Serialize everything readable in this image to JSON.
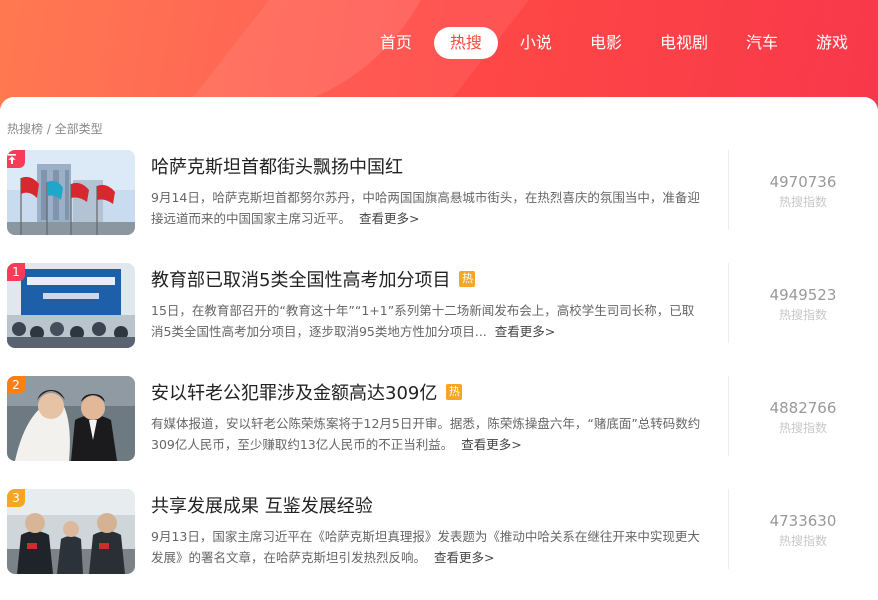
{
  "nav": {
    "items": [
      "首页",
      "热搜",
      "小说",
      "电影",
      "电视剧",
      "汽车",
      "游戏"
    ],
    "active": "热搜"
  },
  "breadcrumb": "热搜榜 / 全部类型",
  "colors": {
    "brand": "#f5493c",
    "rank_top": "#f73c5a",
    "rank_1": "#f73c5a",
    "rank_2": "#ff7f10",
    "rank_3": "#f5a623",
    "hot_badge": "#f5a623"
  },
  "more_label": "查看更多>",
  "score_label": "热搜指数",
  "items": [
    {
      "rank": "置顶",
      "rank_icon": "pin-icon",
      "title": "哈萨克斯坦首都街头飘扬中国红",
      "hot": false,
      "desc": "9月14日，哈萨克斯坦首都努尔苏丹，中哈两国国旗高悬城市街头，在热烈喜庆的氛围当中，准备迎接远道而来的中国国家主席习近平。",
      "score": "4970736"
    },
    {
      "rank": "1",
      "title": "教育部已取消5类全国性高考加分项目",
      "hot": true,
      "hot_label": "热",
      "desc": "15日，在教育部召开的“教育这十年”“1+1”系列第十二场新闻发布会上，高校学生司司长称，已取消5类全国性高考加分项目，逐步取消95类地方性加分项目...",
      "score": "4949523"
    },
    {
      "rank": "2",
      "title": "安以轩老公犯罪涉及金额高达309亿",
      "hot": true,
      "hot_label": "热",
      "desc": "有媒体报道，安以轩老公陈荣炼案将于12月5日开审。据悉，陈荣炼操盘六年，“赌底面”总转码数约309亿人民币，至少赚取约13亿人民币的不正当利益。",
      "score": "4882766"
    },
    {
      "rank": "3",
      "title": "共享发展成果 互鉴发展经验",
      "hot": false,
      "desc": "9月13日，国家主席习近平在《哈萨克斯坦真理报》发表题为《推动中哈关系在继往开来中实现更大发展》的署名文章，在哈萨克斯坦引发热烈反响。",
      "score": "4733630"
    }
  ]
}
